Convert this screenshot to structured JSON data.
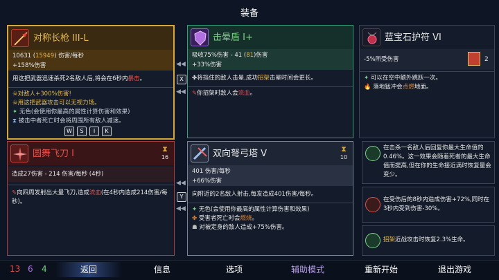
{
  "title": "装备",
  "cards": {
    "a": {
      "name": "对称长枪 III-L",
      "stat1_a": "10631 (",
      "stat1_b": "15949",
      "stat1_c": ") 伤害/每秒",
      "stat2": "+158%伤害",
      "desc_a": "用这把武器迅速杀死2名敌人后,将会在6秒内",
      "desc_b": "暴击",
      "desc_c": "。",
      "aff1": "对敌人+300%伤害!",
      "aff2": "用这把武器攻击可以无视力场。",
      "aff3": "无色(会使用你最高的属性计算伤害和效果)",
      "aff4": "被击中者死亡时会将周围所有敌人减速。"
    },
    "b": {
      "name": "击晕盾 I+",
      "stat1_a": "吸收75%伤害 - 41 (",
      "stat1_b": "81",
      "stat1_c": ")伤害",
      "stat2": "+33%伤害",
      "desc_a": "将挡住的敌人击晕,成功",
      "desc_b": "招架",
      "desc_c": "击晕时间会更长。",
      "aff1_a": "你招架时敌人会",
      "aff1_b": "流血",
      "aff1_c": "。"
    },
    "c": {
      "name": "蓝宝石护符 VI",
      "stat1": "-5%所受伤害",
      "count": "2",
      "aff1": "可以在空中额外跳跃一次。",
      "aff2_a": "落地猛冲会",
      "aff2_b": "点燃",
      "aff2_c": "地面。"
    },
    "d": {
      "name": "圆舞飞刀 I",
      "stat1": "造成27伤害 - 214 伤害/每秒 (4秒)",
      "timer": "16",
      "desc_a": "向四周发射出大量飞刀,造成",
      "desc_b": "流血",
      "desc_c": "(在4秒内造成214伤害/每秒)。"
    },
    "e": {
      "name": "双向弩弓塔 V",
      "stat1": "401 伤害/每秒",
      "stat2": "+66%伤害",
      "timer": "10",
      "desc": "向附近的2名敌人射击,每发造成401伤害/每秒。",
      "aff1": "无色(会使用你最高的属性计算伤害和效果)",
      "aff2_a": "受害者死亡时会",
      "aff2_b": "燃烧",
      "aff2_c": "。",
      "aff3": "对被定身的敌人造成+75%伤害。"
    }
  },
  "keys": {
    "x": "X",
    "y": "Y",
    "w": "W",
    "s": "S",
    "i": "I",
    "k": "K"
  },
  "mutations": [
    {
      "text": "在击杀一名敌人后回复你最大生命值的0.46%。这一效果会随着死者的最大生命值而提高,但在你的生命接近满时恢复量会变少。"
    },
    {
      "text": "在受伤后的8秒内造成伤害+72%,同时在3秒内受到伤害-30%。"
    },
    {
      "text_a": "招架",
      "text_b": "近战攻击时恢复2.3%生命。"
    }
  ],
  "stats": {
    "brutality": "13",
    "tactics": "6",
    "survival": "4"
  },
  "menu": {
    "back": "返回",
    "info": "信息",
    "options": "选项",
    "assist": "辅助模式",
    "restart": "重新开始",
    "quit": "退出游戏"
  },
  "colors": {
    "brutality": "#e0504a",
    "tactics": "#b070e0",
    "survival": "#7fd08a",
    "assist": "#b9a0e8"
  }
}
